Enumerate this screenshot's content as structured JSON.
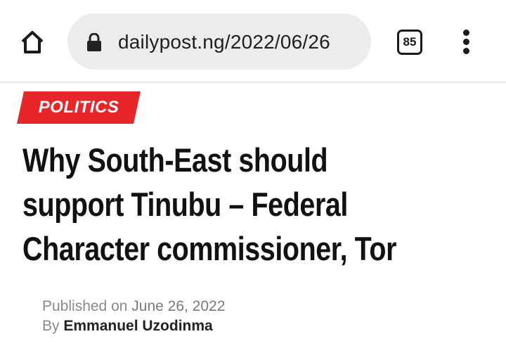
{
  "browser": {
    "url": "dailypost.ng/2022/06/26",
    "tab_count": "85"
  },
  "article": {
    "category": "POLITICS",
    "headline_lines": [
      "Why South-East should",
      "support Tinubu – Federal",
      "Character commissioner, Tor"
    ],
    "published_prefix": "Published on",
    "published_date": "June 26, 2022",
    "by_prefix": "By",
    "author": "Emmanuel Uzodinma"
  },
  "colors": {
    "category_bg": "#e8262a",
    "omnibox_bg": "#ececec"
  }
}
